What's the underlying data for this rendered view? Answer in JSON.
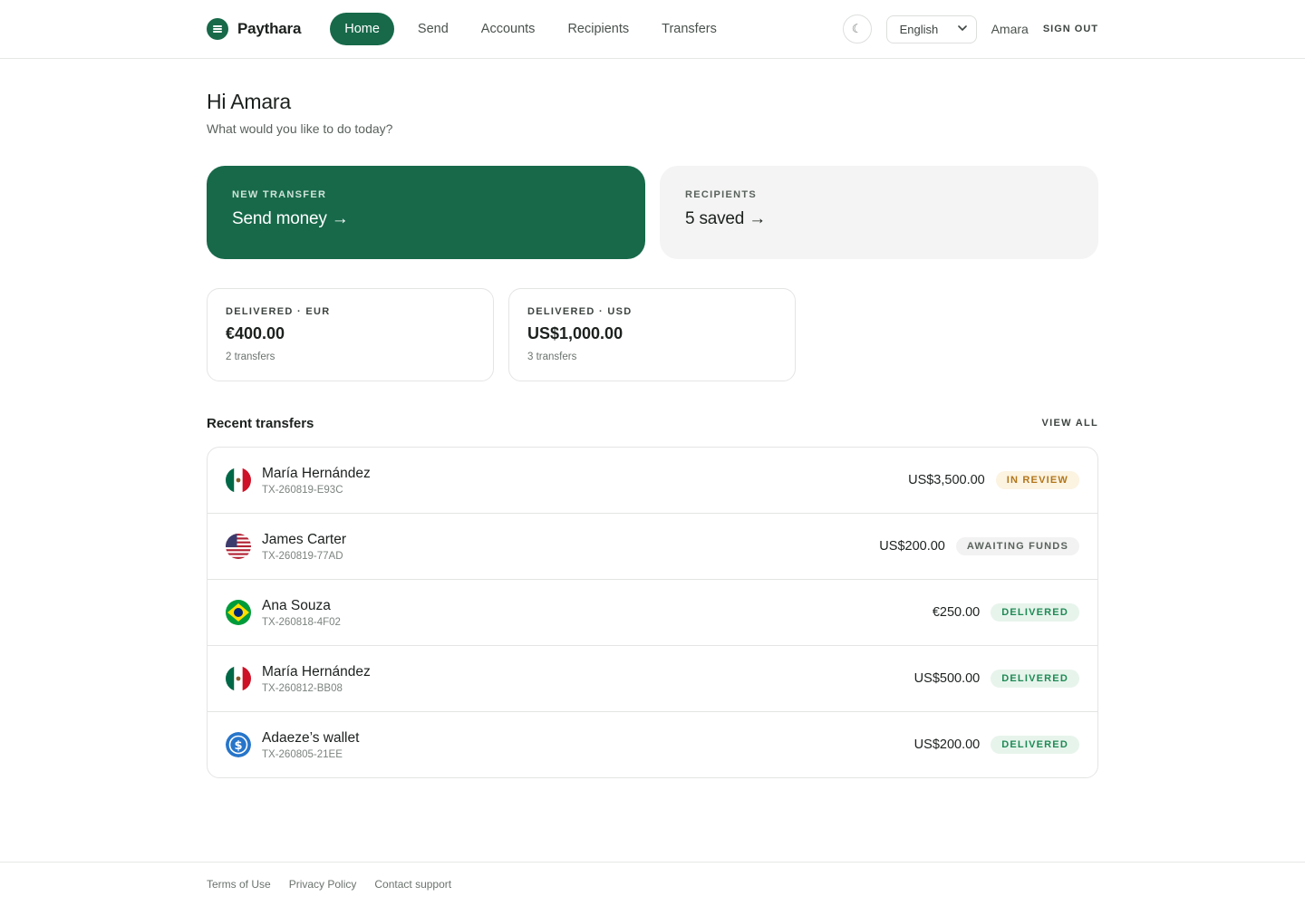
{
  "brand": {
    "name": "Paythara",
    "color": "#17694a"
  },
  "nav": {
    "items": [
      {
        "label": "Home",
        "active": true
      },
      {
        "label": "Send",
        "active": false
      },
      {
        "label": "Accounts",
        "active": false
      },
      {
        "label": "Recipients",
        "active": false
      },
      {
        "label": "Transfers",
        "active": false
      }
    ]
  },
  "header": {
    "theme_icon": "☾",
    "language": "English",
    "user_name": "Amara",
    "sign_out": "SIGN OUT"
  },
  "greeting": {
    "title": "Hi Amara",
    "subtitle": "What would you like to do today?"
  },
  "cta": {
    "primary": {
      "label": "NEW TRANSFER",
      "title": "Send money →"
    },
    "secondary": {
      "label": "RECIPIENTS",
      "title": "5 saved →"
    }
  },
  "stats": [
    {
      "label": "DELIVERED · EUR",
      "amount": "€400.00",
      "sub": "2 transfers"
    },
    {
      "label": "DELIVERED · USD",
      "amount": "US$1,000.00",
      "sub": "3 transfers"
    }
  ],
  "recent": {
    "title": "Recent transfers",
    "view_all": "VIEW ALL",
    "rows": [
      {
        "flag": "mexico-flag-icon",
        "name": "María Hernández",
        "ref": "TX-260819-E93C",
        "amount": "US$3,500.00",
        "status": "IN REVIEW",
        "status_kind": "review"
      },
      {
        "flag": "usa-flag-icon",
        "name": "James Carter",
        "ref": "TX-260819-77AD",
        "amount": "US$200.00",
        "status": "AWAITING FUNDS",
        "status_kind": "awaiting"
      },
      {
        "flag": "brazil-flag-icon",
        "name": "Ana Souza",
        "ref": "TX-260818-4F02",
        "amount": "€250.00",
        "status": "DELIVERED",
        "status_kind": "delivered"
      },
      {
        "flag": "mexico-flag-icon",
        "name": "María Hernández",
        "ref": "TX-260812-BB08",
        "amount": "US$500.00",
        "status": "DELIVERED",
        "status_kind": "delivered"
      },
      {
        "flag": "usdc-wallet-icon",
        "name": "Adaeze’s wallet",
        "ref": "TX-260805-21EE",
        "amount": "US$200.00",
        "status": "DELIVERED",
        "status_kind": "delivered"
      }
    ]
  },
  "footer": {
    "links": [
      "Terms of Use",
      "Privacy Policy",
      "Contact support"
    ]
  }
}
